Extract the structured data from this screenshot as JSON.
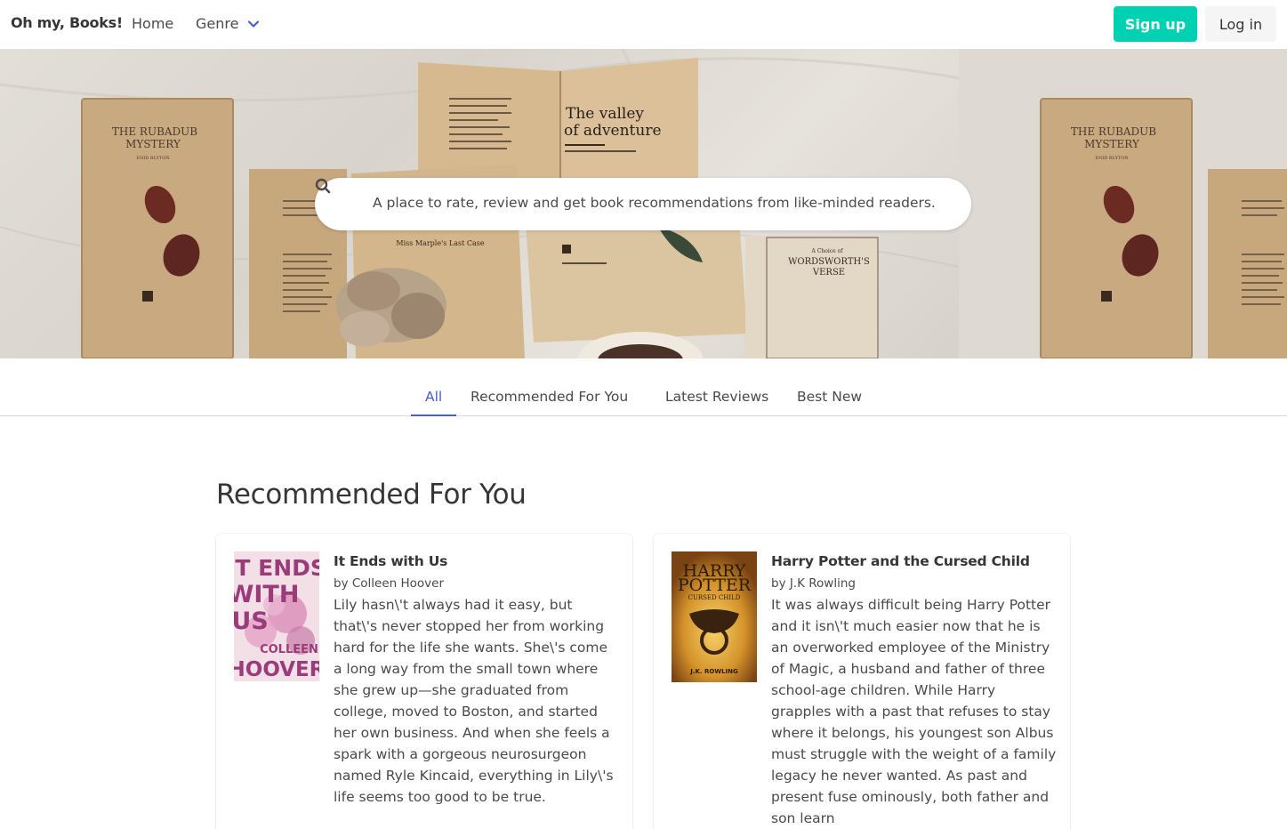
{
  "navbar": {
    "brand": "Oh my, Books!",
    "home": "Home",
    "genre": "Genre",
    "signup": "Sign up",
    "login": "Log in"
  },
  "hero": {
    "search_text": "A place to rate, review and get book recommendations from like-minded readers.",
    "book_titles": [
      "THE RUBADUB MYSTERY",
      "The valley of adventure",
      "A Choice of WORDSWORTH'S VERSE",
      "Miss Marple's Last Case"
    ]
  },
  "tabs": [
    {
      "label": "All",
      "active": true
    },
    {
      "label": "Recommended For You",
      "active": false
    },
    {
      "label": "Latest Reviews",
      "active": false
    },
    {
      "label": "Best New",
      "active": false
    }
  ],
  "section": {
    "title": "Recommended For You"
  },
  "books": [
    {
      "title": "It Ends with Us",
      "author": "by Colleen Hoover",
      "description": "Lily hasn\\'t always had it easy, but that\\'s never stopped her from working hard for the life she wants. She\\'s come a long way from the small town where she grew up—she graduated from college, moved to Boston, and started her own business. And when she feels a spark with a gorgeous neurosurgeon named Ryle Kincaid, everything in Lily\\'s life seems too good to be true.",
      "cover_text": [
        "IT ENDS",
        "WITH",
        "US",
        "COLLEEN",
        "HOOVER"
      ]
    },
    {
      "title": "Harry Potter and the Cursed Child",
      "author": "by J.K Rowling",
      "description": "It was always difficult being Harry Potter and it isn\\'t much easier now that he is an overworked employee of the Ministry of Magic, a husband and father of three school-age children. While Harry grapples with a past that refuses to stay where it belongs, his youngest son Albus must struggle with the weight of a family legacy he never wanted. As past and present fuse ominously, both father and son learn",
      "cover_text": [
        "HARRY",
        "POTTER",
        "CURSED CHILD",
        "J.K. ROWLING"
      ]
    }
  ],
  "colors": {
    "accent": "#00d1b2",
    "link": "#485fc7",
    "text": "#363636"
  }
}
